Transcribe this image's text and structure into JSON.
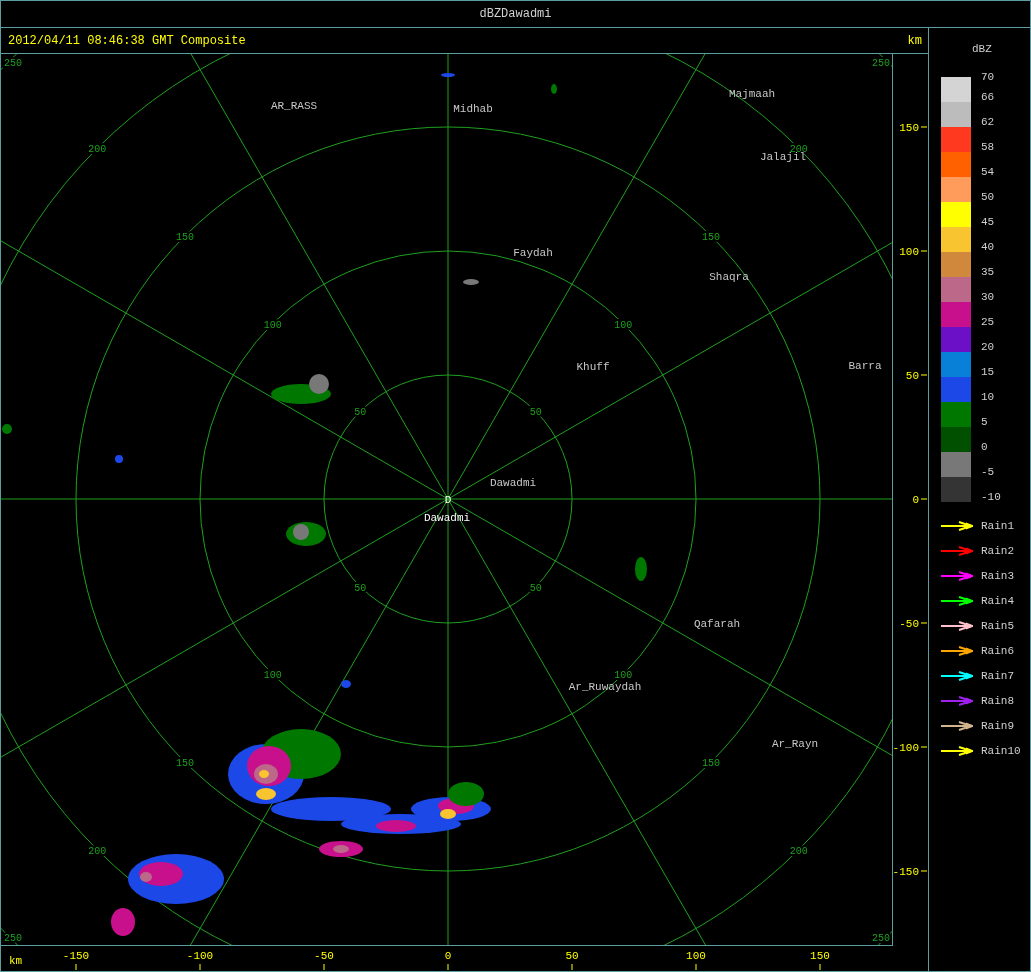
{
  "window": {
    "title": "dBZDawadmi"
  },
  "header": {
    "timestamp": "2012/04/11 08:46:38 GMT Composite",
    "unit": "km"
  },
  "map": {
    "rings": [
      {
        "labels": [
          "50",
          "50",
          "50",
          "50"
        ]
      },
      {
        "labels": [
          "100",
          "100",
          "100",
          "100"
        ]
      },
      {
        "labels": [
          "150",
          "150",
          "150",
          "150"
        ]
      },
      {
        "labels": [
          "200",
          "200",
          "200",
          "200"
        ]
      },
      {
        "labels": [
          "250",
          "250",
          "250",
          "250"
        ]
      }
    ],
    "radar_marker": "D",
    "places": [
      {
        "name": "AR_RASS"
      },
      {
        "name": "Midhab"
      },
      {
        "name": "Majmaah"
      },
      {
        "name": "Jalajil"
      },
      {
        "name": "Faydah"
      },
      {
        "name": "Shaqra"
      },
      {
        "name": "Khuff"
      },
      {
        "name": "Barra"
      },
      {
        "name": "Dawadmi"
      },
      {
        "name": "Dawadmi"
      },
      {
        "name": "Qafarah"
      },
      {
        "name": "Ar_Ruwaydah"
      },
      {
        "name": "Ar_Rayn"
      }
    ]
  },
  "y_axis": {
    "ticks": [
      "150",
      "100",
      "50",
      "0",
      "-50",
      "-100",
      "-150"
    ]
  },
  "x_axis": {
    "unit": "km",
    "ticks": [
      "-150",
      "-100",
      "-50",
      "0",
      "50",
      "100",
      "150"
    ]
  },
  "legend": {
    "title": "dBZ",
    "bands": [
      {
        "color": "#d4d4d4"
      },
      {
        "color": "#bcbcbc"
      },
      {
        "color": "#ff3820"
      },
      {
        "color": "#ff6000"
      },
      {
        "color": "#ff9c5c"
      },
      {
        "color": "#ffff00"
      },
      {
        "color": "#f8c430"
      },
      {
        "color": "#d0883c"
      },
      {
        "color": "#bc6888"
      },
      {
        "color": "#c8108c"
      },
      {
        "color": "#6c10c8"
      },
      {
        "color": "#0880d8"
      },
      {
        "color": "#1c48e8"
      },
      {
        "color": "#007800"
      },
      {
        "color": "#005000"
      },
      {
        "color": "#787878"
      },
      {
        "color": "#343434"
      }
    ],
    "ticks": [
      "70",
      "66",
      "62",
      "58",
      "54",
      "50",
      "45",
      "40",
      "35",
      "30",
      "25",
      "20",
      "15",
      "10",
      "5",
      "0",
      "-5",
      "-10"
    ],
    "tracks": [
      {
        "label": "Rain1",
        "color": "#ffff00"
      },
      {
        "label": "Rain2",
        "color": "#ff0000"
      },
      {
        "label": "Rain3",
        "color": "#ff00ff"
      },
      {
        "label": "Rain4",
        "color": "#00ff00"
      },
      {
        "label": "Rain5",
        "color": "#ffc0cb"
      },
      {
        "label": "Rain6",
        "color": "#ffa500"
      },
      {
        "label": "Rain7",
        "color": "#00ffff"
      },
      {
        "label": "Rain8",
        "color": "#a020f0"
      },
      {
        "label": "Rain9",
        "color": "#d2b48c"
      },
      {
        "label": "Rain10",
        "color": "#ffff00"
      }
    ]
  }
}
